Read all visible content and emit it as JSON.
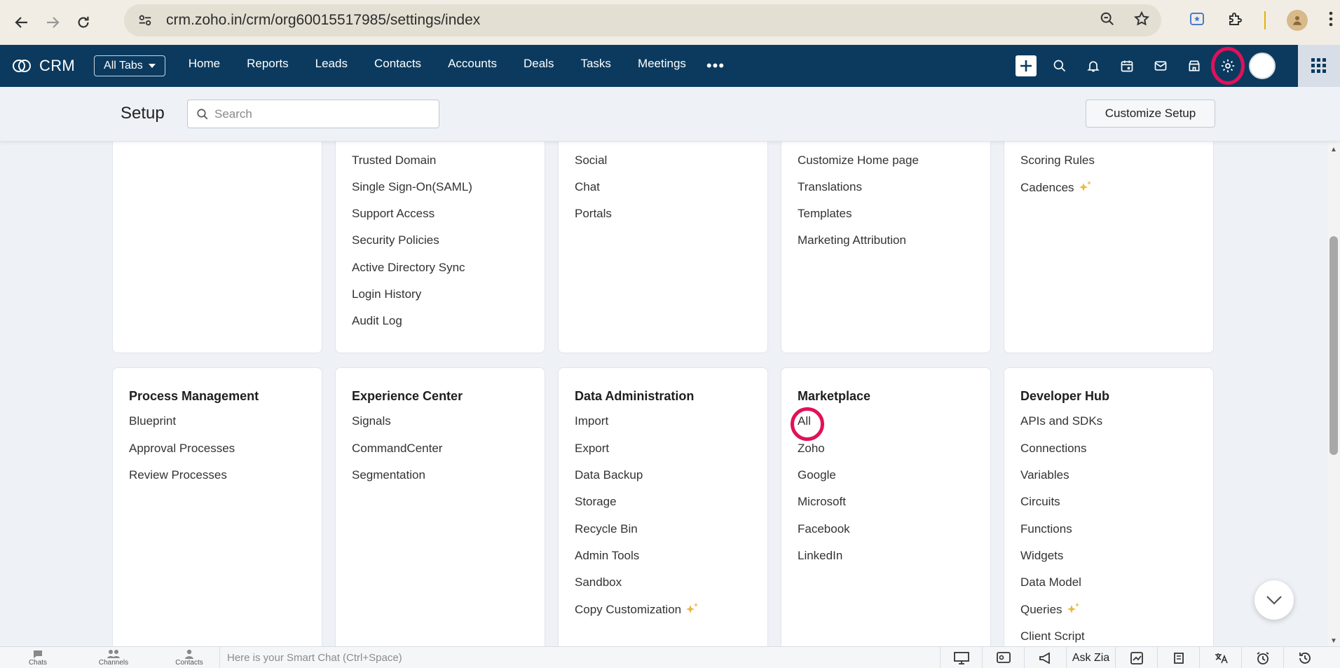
{
  "browser": {
    "url": "crm.zoho.in/crm/org60015517985/settings/index"
  },
  "header": {
    "logo_text": "CRM",
    "all_tabs_label": "All Tabs",
    "tabs": [
      "Home",
      "Reports",
      "Leads",
      "Contacts",
      "Accounts",
      "Deals",
      "Tasks",
      "Meetings"
    ],
    "more_label": "•••",
    "highlight_color": "#e0115a"
  },
  "setup": {
    "title": "Setup",
    "search_placeholder": "Search",
    "customize_label": "Customize Setup"
  },
  "top_cards": [
    {
      "items": []
    },
    {
      "items": [
        "Trusted Domain",
        "Single Sign-On(SAML)",
        "Support Access",
        "Security Policies",
        "Active Directory Sync",
        "Login History",
        "Audit Log"
      ]
    },
    {
      "items": [
        "Social",
        "Chat",
        "Portals"
      ]
    },
    {
      "items": [
        "Customize Home page",
        "Translations",
        "Templates",
        "Marketing Attribution"
      ]
    },
    {
      "items": [
        "Scoring Rules",
        "Cadences"
      ]
    }
  ],
  "bottom_cards": [
    {
      "title": "Process Management",
      "items": [
        "Blueprint",
        "Approval Processes",
        "Review Processes"
      ]
    },
    {
      "title": "Experience Center",
      "items": [
        "Signals",
        "CommandCenter",
        "Segmentation"
      ]
    },
    {
      "title": "Data Administration",
      "items": [
        "Import",
        "Export",
        "Data Backup",
        "Storage",
        "Recycle Bin",
        "Admin Tools",
        "Sandbox",
        "Copy Customization"
      ]
    },
    {
      "title": "Marketplace",
      "items": [
        "All",
        "Zoho",
        "Google",
        "Microsoft",
        "Facebook",
        "LinkedIn"
      ]
    },
    {
      "title": "Developer Hub",
      "items": [
        "APIs and SDKs",
        "Connections",
        "Variables",
        "Circuits",
        "Functions",
        "Widgets",
        "Data Model",
        "Queries",
        "Client Script"
      ]
    }
  ],
  "bottom_bar": {
    "tabs": [
      "Chats",
      "Channels",
      "Contacts"
    ],
    "smart_chat_placeholder": "Here is your Smart Chat (Ctrl+Space)",
    "ask_zia": "Ask Zia"
  }
}
